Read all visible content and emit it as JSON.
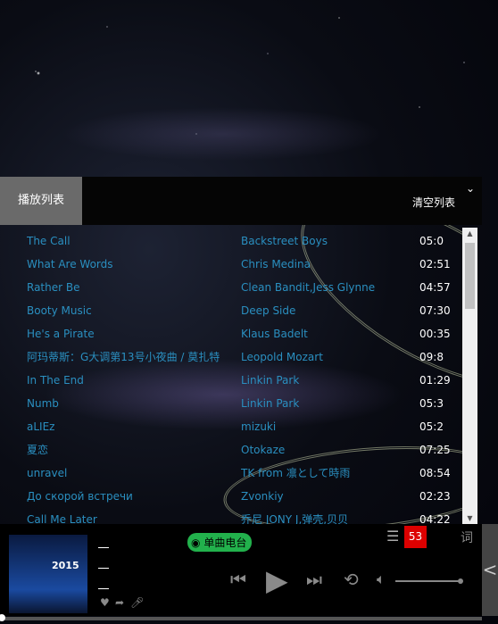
{
  "playlist": {
    "tab_label": "播放列表",
    "clear_label": "清空列表",
    "collapse_icon": "chevron-down",
    "songs": [
      {
        "title": "The Call",
        "artist": "Backstreet Boys",
        "duration": "05:0"
      },
      {
        "title": "What Are Words",
        "artist": "Chris Medina",
        "duration": "02:51"
      },
      {
        "title": "Rather Be",
        "artist": "Clean Bandit,Jess Glynne",
        "duration": "04:57"
      },
      {
        "title": "Booty Music",
        "artist": "Deep Side",
        "duration": "07:30"
      },
      {
        "title": "He's a Pirate",
        "artist": "Klaus Badelt",
        "duration": "00:35"
      },
      {
        "title": "阿玛蒂斯：G大调第13号小夜曲 / 莫扎特",
        "artist": "Leopold Mozart",
        "duration": "09:8"
      },
      {
        "title": "In The End",
        "artist": "Linkin Park",
        "duration": "01:29"
      },
      {
        "title": "Numb",
        "artist": "Linkin Park",
        "duration": "05:3"
      },
      {
        "title": "aLIEz",
        "artist": "mizuki",
        "duration": "05:2"
      },
      {
        "title": "夏恋",
        "artist": "Otokaze",
        "duration": "07:25"
      },
      {
        "title": "unravel",
        "artist": "TK from 凛として時雨",
        "duration": "08:54"
      },
      {
        "title": "До скорой встречи",
        "artist": "Zvonkiy",
        "duration": "02:23"
      },
      {
        "title": "Call Me Later",
        "artist": "乔尼 JONY J,弹壳,贝贝",
        "duration": "04:22"
      }
    ]
  },
  "player": {
    "radio_label": "单曲电台",
    "playlist_count": "53",
    "lyrics_label": "词",
    "album_year": "2015",
    "side_toggle": "<"
  }
}
